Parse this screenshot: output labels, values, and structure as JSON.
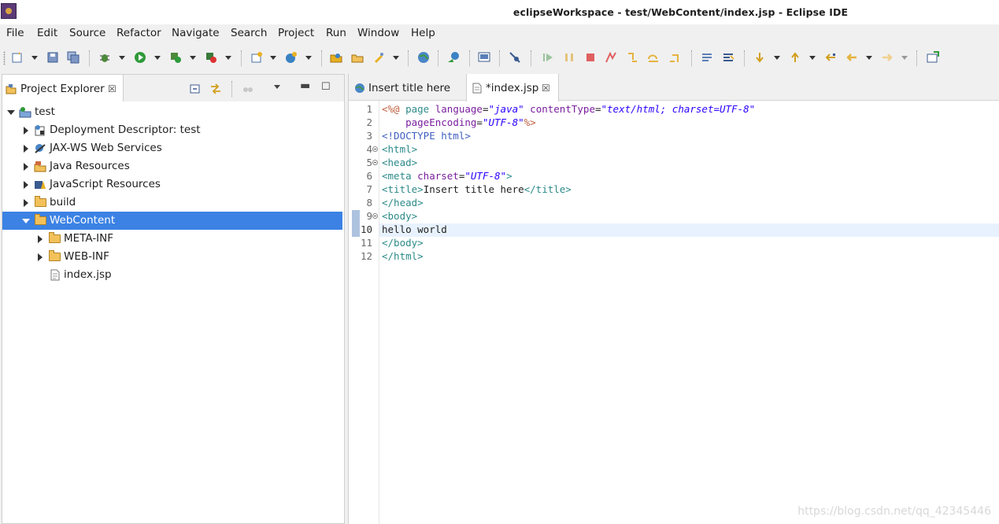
{
  "window": {
    "title": "eclipseWorkspace - test/WebContent/index.jsp - Eclipse IDE"
  },
  "menu": [
    "File",
    "Edit",
    "Source",
    "Refactor",
    "Navigate",
    "Search",
    "Project",
    "Run",
    "Window",
    "Help"
  ],
  "explorer": {
    "tab_label": "Project Explorer",
    "tree": [
      {
        "label": "test",
        "state": "expanded",
        "icon": "project-icon"
      },
      {
        "label": "Deployment Descriptor: test",
        "state": "collapsed",
        "icon": "deployment-descriptor-icon"
      },
      {
        "label": "JAX-WS Web Services",
        "state": "collapsed",
        "icon": "web-services-icon"
      },
      {
        "label": "Java Resources",
        "state": "collapsed",
        "icon": "java-resources-icon"
      },
      {
        "label": "JavaScript Resources",
        "state": "collapsed",
        "icon": "javascript-resources-icon"
      },
      {
        "label": "build",
        "state": "collapsed",
        "icon": "folder-icon"
      },
      {
        "label": "WebContent",
        "state": "expanded",
        "icon": "folder-open-icon",
        "selected": true
      },
      {
        "label": "META-INF",
        "state": "collapsed",
        "icon": "folder-icon"
      },
      {
        "label": "WEB-INF",
        "state": "collapsed",
        "icon": "folder-icon"
      },
      {
        "label": "index.jsp",
        "state": "leaf",
        "icon": "file-icon"
      }
    ]
  },
  "editor": {
    "tabs": [
      {
        "label": "Insert title here",
        "active": false,
        "icon": "globe-icon"
      },
      {
        "label": "*index.jsp",
        "active": true,
        "icon": "jsp-file-icon"
      }
    ],
    "line_numbers": [
      "1",
      "2",
      "3",
      "4",
      "5",
      "6",
      "7",
      "8",
      "9",
      "10",
      "11",
      "12"
    ],
    "current_line": "10",
    "code": {
      "l1": {
        "a": "<%@ ",
        "b": "page ",
        "c": "language",
        "d": "=",
        "e": "\"java\"",
        "f": " contentType",
        "g": "=",
        "h": "\"text/html; charset=UTF-8\""
      },
      "l2": {
        "indent": "    ",
        "a": "pageEncoding",
        "b": "=",
        "c": "\"UTF-8\"",
        "d": "%>"
      },
      "l3": "<!DOCTYPE html>",
      "l4": "<html>",
      "l5": "<head>",
      "l6": {
        "a": "<meta ",
        "b": "charset",
        "c": "=",
        "d": "\"UTF-8\"",
        "e": ">"
      },
      "l7": {
        "a": "<title>",
        "b": "Insert title here",
        "c": "</title>"
      },
      "l8": "</head>",
      "l9": "<body>",
      "l10": "hello world",
      "l11": "</body>",
      "l12": "</html>"
    }
  },
  "watermark": "https://blog.csdn.net/qq_42345446"
}
